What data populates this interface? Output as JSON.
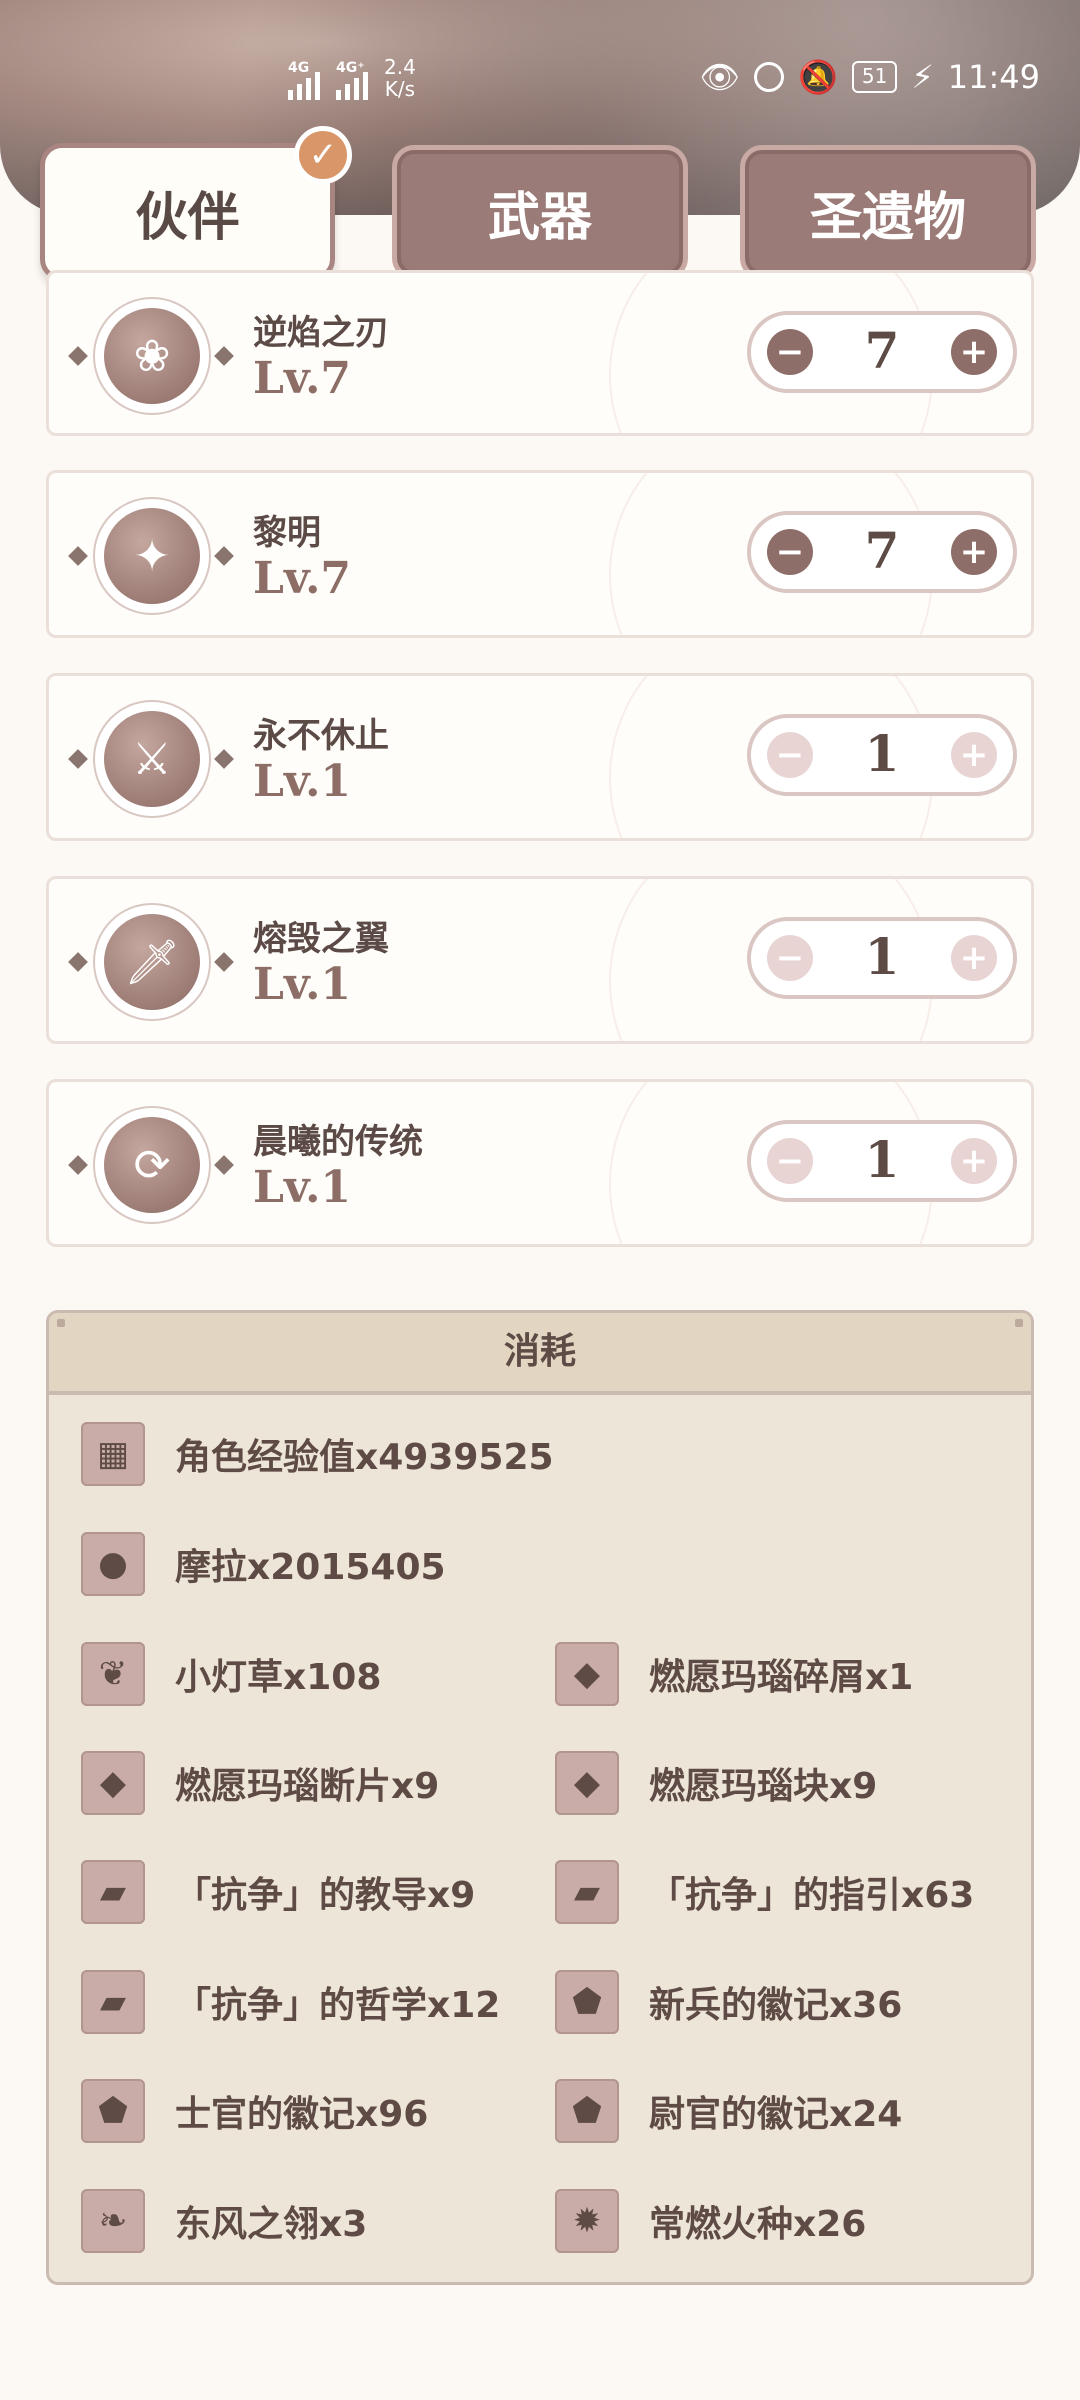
{
  "status_bar": {
    "net1": "4G",
    "net2": "4G⁺",
    "speed": "2.4",
    "speed_unit": "K/s",
    "battery": "51",
    "time": "11:49"
  },
  "tabs": [
    {
      "label": "伙伴",
      "active": true
    },
    {
      "label": "武器",
      "active": false
    },
    {
      "label": "圣遗物",
      "active": false
    }
  ],
  "talents": [
    {
      "name": "逆焰之刃",
      "level": "Lv.7",
      "value": "7",
      "icon": "flame-blade-icon",
      "glyph": "❀"
    },
    {
      "name": "黎明",
      "level": "Lv.7",
      "value": "7",
      "icon": "phoenix-icon",
      "glyph": "✦"
    },
    {
      "name": "永不休止",
      "level": "Lv.1",
      "value": "1",
      "icon": "slash-icon",
      "glyph": "⚔"
    },
    {
      "name": "熔毁之翼",
      "level": "Lv.1",
      "value": "1",
      "icon": "sword-fire-icon",
      "glyph": "🗡"
    },
    {
      "name": "晨曦的传统",
      "level": "Lv.1",
      "value": "1",
      "icon": "sword-cycle-icon",
      "glyph": "⟳"
    }
  ],
  "stepper": {
    "minus": "−",
    "plus": "+"
  },
  "consume": {
    "title": "消耗",
    "items": [
      {
        "label": "角色经验值x4939525",
        "icon": "exp-book-icon",
        "glyph": "▦"
      },
      {
        "label": "摩拉x2015405",
        "icon": "mora-coin-icon",
        "glyph": "●"
      },
      {
        "label": "小灯草x108",
        "icon": "small-lamp-grass-icon",
        "glyph": "❦"
      },
      {
        "label": "燃愿玛瑙碎屑x1",
        "icon": "agate-sliver-icon",
        "glyph": "◆"
      },
      {
        "label": "燃愿玛瑙断片x9",
        "icon": "agate-fragment-icon",
        "glyph": "◆"
      },
      {
        "label": "燃愿玛瑙块x9",
        "icon": "agate-chunk-icon",
        "glyph": "◆"
      },
      {
        "label": "「抗争」的教导x9",
        "icon": "teachings-book-icon",
        "glyph": "▰"
      },
      {
        "label": "「抗争」的指引x63",
        "icon": "guide-book-icon",
        "glyph": "▰"
      },
      {
        "label": "「抗争」的哲学x12",
        "icon": "philosophies-book-icon",
        "glyph": "▰"
      },
      {
        "label": "新兵的徽记x36",
        "icon": "recruit-insignia-icon",
        "glyph": "⬟"
      },
      {
        "label": "士官的徽记x96",
        "icon": "sergeant-insignia-icon",
        "glyph": "⬟"
      },
      {
        "label": "尉官的徽记x24",
        "icon": "lieutenant-insignia-icon",
        "glyph": "⬟"
      },
      {
        "label": "东风之翎x3",
        "icon": "dvalin-plume-icon",
        "glyph": "❧"
      },
      {
        "label": "常燃火种x26",
        "icon": "everflame-seed-icon",
        "glyph": "✹"
      }
    ]
  },
  "colors": {
    "accent": "#9b7b77",
    "check": "#d99668",
    "panel": "#ede5d7"
  }
}
